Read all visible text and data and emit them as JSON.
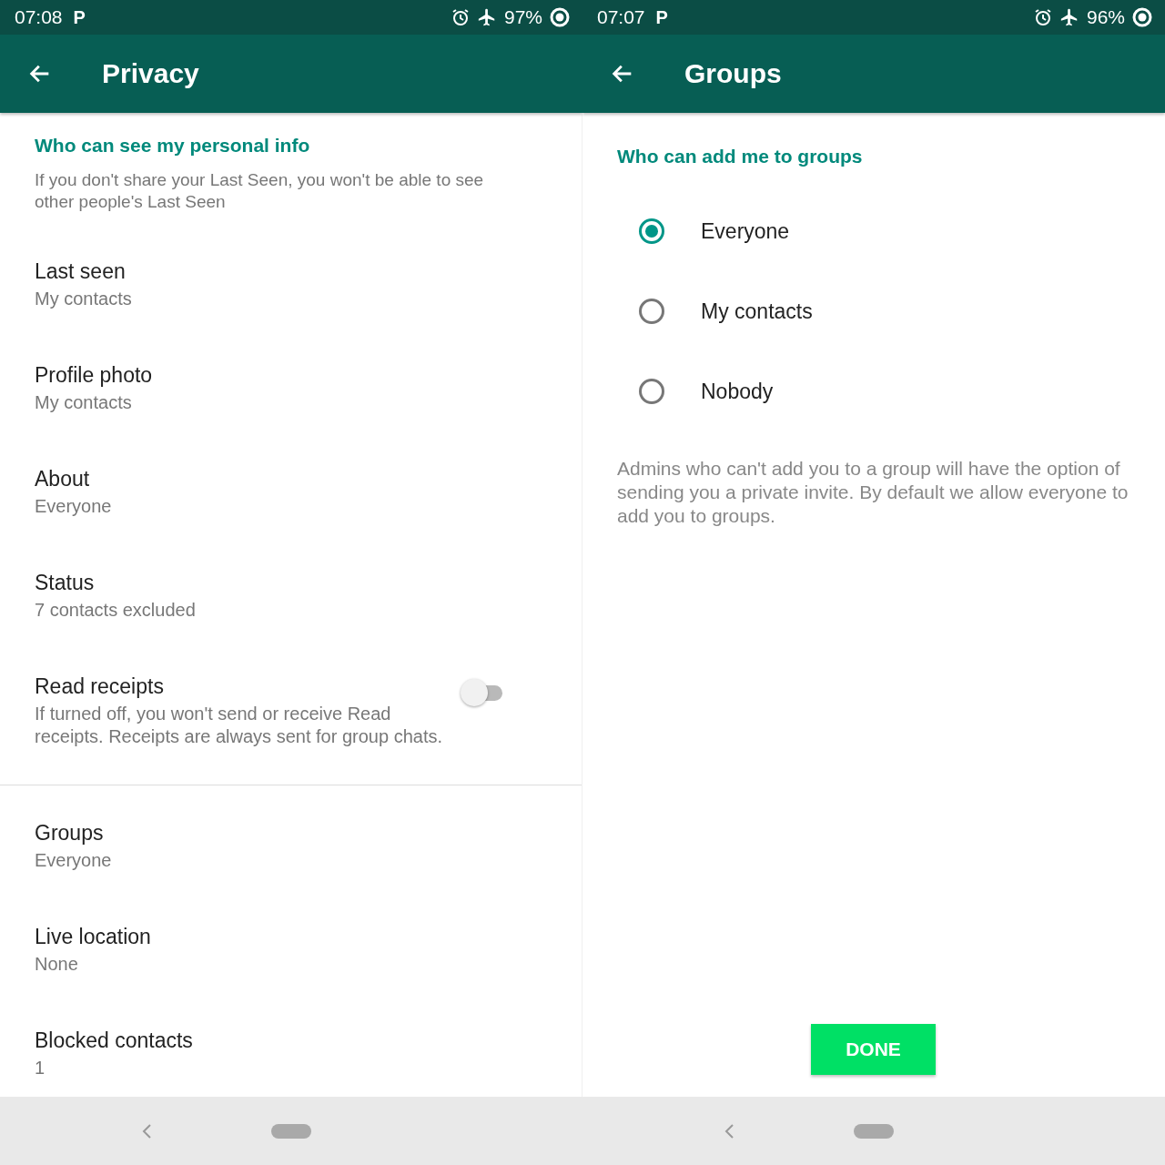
{
  "screens": [
    {
      "status": {
        "time": "07:08",
        "notification": "P",
        "battery": "97%"
      },
      "title": "Privacy",
      "kind": "privacy",
      "section": {
        "heading": "Who can see my personal info",
        "note": "If you don't share your Last Seen, you won't be able to see other people's Last Seen"
      },
      "groups": [
        [
          {
            "kind": "setting",
            "title": "Last seen",
            "value": "My contacts"
          },
          {
            "kind": "setting",
            "title": "Profile photo",
            "value": "My contacts"
          },
          {
            "kind": "setting",
            "title": "About",
            "value": "Everyone"
          },
          {
            "kind": "setting",
            "title": "Status",
            "value": "7 contacts excluded"
          },
          {
            "kind": "toggle",
            "title": "Read receipts",
            "value": "If turned off, you won't send or receive Read receipts. Receipts are always sent for group chats.",
            "on": false
          }
        ],
        [
          {
            "kind": "setting",
            "title": "Groups",
            "value": "Everyone"
          },
          {
            "kind": "setting",
            "title": "Live location",
            "value": "None"
          },
          {
            "kind": "setting",
            "title": "Blocked contacts",
            "value": "1"
          }
        ]
      ]
    },
    {
      "status": {
        "time": "07:07",
        "notification": "P",
        "battery": "96%"
      },
      "title": "Groups",
      "kind": "groups",
      "heading": "Who can add me to groups",
      "options": [
        {
          "label": "Everyone",
          "selected": true
        },
        {
          "label": "My contacts",
          "selected": false
        },
        {
          "label": "Nobody",
          "selected": false
        }
      ],
      "note": "Admins who can't add you to a group will have the option of sending you a private invite. By default we allow everyone to add you to groups.",
      "button": "DONE"
    }
  ]
}
